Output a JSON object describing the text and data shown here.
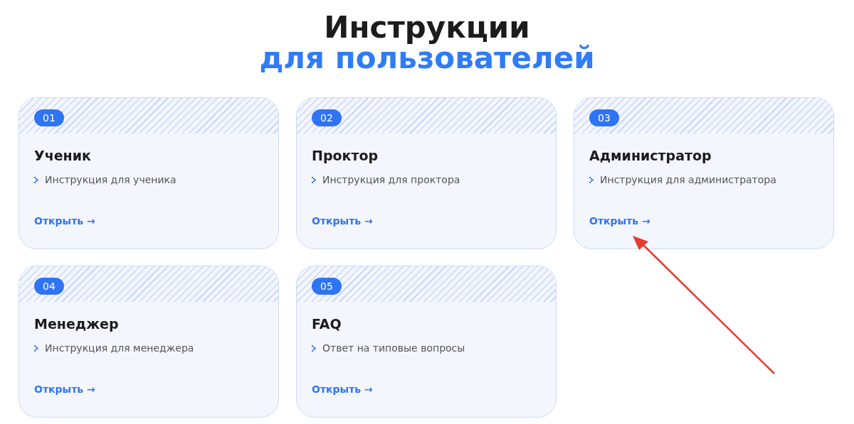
{
  "heading": {
    "line_1": "Инструкции",
    "line_2": "для пользователей"
  },
  "cards": [
    {
      "number": "01",
      "title": "Ученик",
      "item": "Инструкция для ученика",
      "link": "Открыть →"
    },
    {
      "number": "02",
      "title": "Проктор",
      "item": "Инструкция для проктора",
      "link": "Открыть →"
    },
    {
      "number": "03",
      "title": "Администратор",
      "item": "Инструкция для администратора",
      "link": "Открыть →"
    },
    {
      "number": "04",
      "title": "Менеджер",
      "item": "Инструкция для менеджера",
      "link": "Открыть →"
    },
    {
      "number": "05",
      "title": "FAQ",
      "item": "Ответ на типовые вопросы",
      "link": "Открыть →"
    }
  ]
}
